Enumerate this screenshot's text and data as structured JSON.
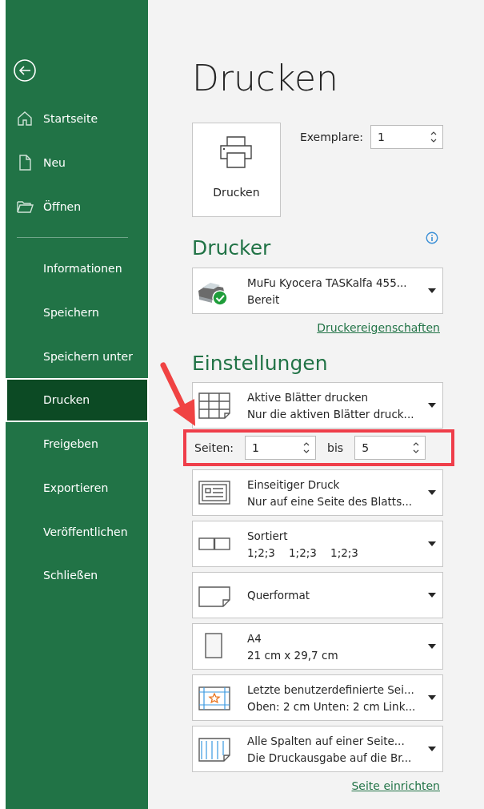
{
  "sidebar": {
    "items": [
      {
        "label": "Startseite",
        "kind": "home",
        "selected": false
      },
      {
        "label": "Neu",
        "kind": "document",
        "selected": false
      },
      {
        "label": "Öffnen",
        "kind": "folder",
        "selected": false
      },
      {
        "kind": "divider"
      },
      {
        "label": "Informationen",
        "selected": false
      },
      {
        "label": "Speichern",
        "selected": false
      },
      {
        "label": "Speichern unter",
        "selected": false
      },
      {
        "label": "Drucken",
        "selected": true
      },
      {
        "label": "Freigeben",
        "selected": false
      },
      {
        "label": "Exportieren",
        "selected": false
      },
      {
        "label": "Veröffentlichen",
        "selected": false
      },
      {
        "label": "Schließen",
        "selected": false
      }
    ]
  },
  "title": "Drucken",
  "print_button": {
    "label": "Drucken"
  },
  "copies": {
    "label": "Exemplare:",
    "value": "1"
  },
  "printer_section": {
    "heading": "Drucker",
    "printer": {
      "name": "MuFu Kyocera TASKalfa 455...",
      "status": "Bereit"
    },
    "link": "Druckereigenschaften"
  },
  "settings_section": {
    "heading": "Einstellungen",
    "settings": [
      {
        "kind": "sheets",
        "title": "Aktive Blätter drucken",
        "subtitle": "Nur die aktiven Blätter druck..."
      },
      {
        "kind": "pages",
        "label": "Seiten:",
        "from": "1",
        "to_label": "bis",
        "to": "5",
        "highlighted": true
      },
      {
        "kind": "duplex",
        "title": "Einseitiger Druck",
        "subtitle": "Nur auf eine Seite des Blatts..."
      },
      {
        "kind": "collate",
        "title": "Sortiert",
        "subtitle": "1;2;3    1;2;3    1;2;3"
      },
      {
        "kind": "orientation",
        "title": "Querformat"
      },
      {
        "kind": "paper",
        "title": "A4",
        "subtitle": "21 cm x 29,7 cm"
      },
      {
        "kind": "margins",
        "title": "Letzte benutzerdefinierte Sei...",
        "subtitle": "Oben: 2 cm Unten: 2 cm Link..."
      },
      {
        "kind": "scaling",
        "title": "Alle Spalten auf einer Seite...",
        "subtitle": "Die Druckausgabe auf die Br..."
      }
    ],
    "link": "Seite einrichten"
  }
}
